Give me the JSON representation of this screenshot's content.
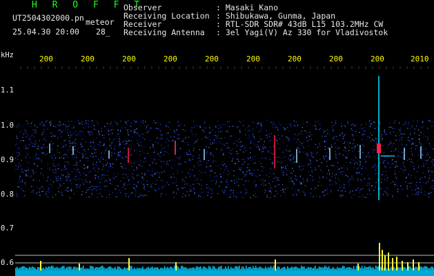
{
  "header": {
    "brand": "H R O F F T",
    "filename": "UT2504302000.pn",
    "mode": "meteor",
    "timestamp": "25.04.30 20:00",
    "count": "28_",
    "info": [
      {
        "label": "Observer",
        "value": ": Masaki Kano"
      },
      {
        "label": "Receiving Location",
        "value": ": Shibukawa, Gunma, Japan"
      },
      {
        "label": "Receiver",
        "value": ": RTL-SDR SDR# 43dB L15 103.2MHz CW"
      },
      {
        "label": "Receiving Antenna",
        "value": ": 3el Yagi(V) Az 330 for Vladivostok"
      }
    ]
  },
  "axis": {
    "unit": "kHz",
    "y_ticks": [
      "1.1",
      "1.0",
      "0.9",
      "0.8",
      "0.7",
      "0.6"
    ],
    "time_labels": [
      "200",
      "200",
      "200",
      "200",
      "200",
      "200",
      "200",
      "200",
      "200",
      "2010"
    ]
  },
  "colors": {
    "background": "#000000",
    "text_white": "#e8e8e8",
    "text_yellow": "#ffff00",
    "brand_green": "#22ff22",
    "signal_cyan": "#00e5ff",
    "meteor_red": "#ff2050"
  }
}
